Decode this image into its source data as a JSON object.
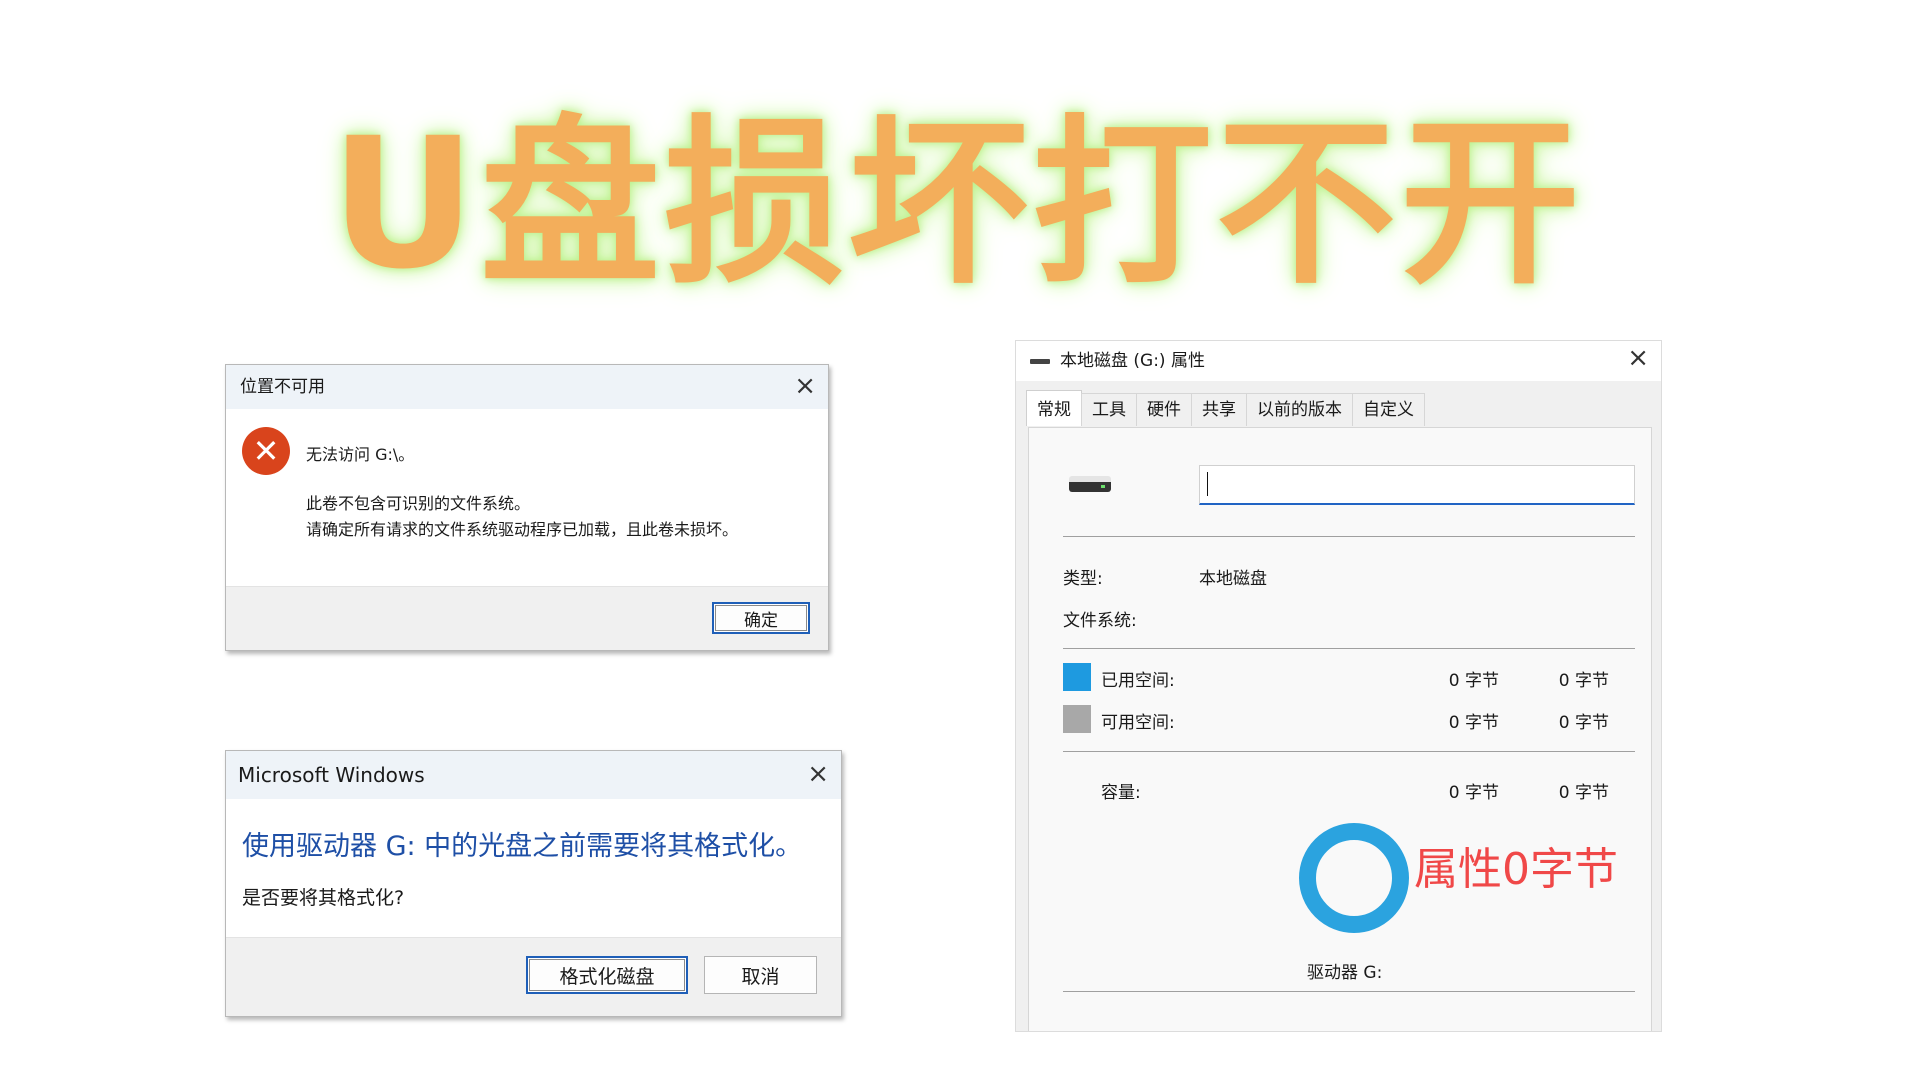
{
  "headline": "U盘损坏打不开",
  "colors": {
    "headline": "#f3ae5b",
    "glow": "#b9f08a",
    "accent_blue": "#2164c4",
    "used_space": "#1e9ae0",
    "free_space": "#a8a8a8",
    "chart_ring": "#2ba3df",
    "annotation": "#f04848"
  },
  "dialog_unavailable": {
    "title": "位置不可用",
    "close_icon": "×",
    "icon": "error-icon",
    "icon_glyph": "✕",
    "message": "无法访问 G:\\。",
    "detail_line1": "此卷不包含可识别的文件系统。",
    "detail_line2": "请确定所有请求的文件系统驱动程序已加载，且此卷未损坏。",
    "ok_label": "确定"
  },
  "dialog_format": {
    "title": "Microsoft Windows",
    "close_icon": "×",
    "main_instruction": "使用驱动器 G: 中的光盘之前需要将其格式化。",
    "question": "是否要将其格式化?",
    "format_label": "格式化磁盘",
    "cancel_label": "取消"
  },
  "properties": {
    "title": "本地磁盘 (G:) 属性",
    "close_icon": "×",
    "tabs": [
      "常规",
      "工具",
      "硬件",
      "共享",
      "以前的版本",
      "自定义"
    ],
    "active_tab": "常规",
    "name_value": "",
    "type_label": "类型:",
    "type_value": "本地磁盘",
    "fs_label": "文件系统:",
    "used_label": "已用空间:",
    "used_bytes": "0 字节",
    "used_size": "0 字节",
    "free_label": "可用空间:",
    "free_bytes": "0 字节",
    "free_size": "0 字节",
    "capacity_label": "容量:",
    "capacity_bytes": "0 字节",
    "capacity_size": "0 字节",
    "annotation": "属性0字节",
    "drive_label": "驱动器 G:"
  }
}
